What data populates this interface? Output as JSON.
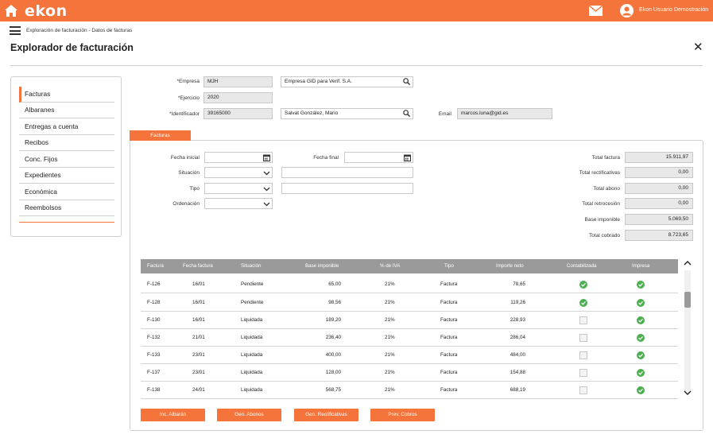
{
  "brand": {
    "logo_text": "ekon",
    "accent_color": "#f4743b"
  },
  "header": {
    "user_name": "Ekon Usuario Demostración",
    "home_icon": "home-icon",
    "mail_icon": "mail-icon",
    "user_icon": "user-circle-icon"
  },
  "breadcrumb": "Exploración de facturación - Datos de facturas",
  "page_title": "Explorador de facturación",
  "sidebar": {
    "items": [
      {
        "label": "Facturas",
        "active": true
      },
      {
        "label": "Albaranes"
      },
      {
        "label": "Entregas a cuenta"
      },
      {
        "label": "Recibos"
      },
      {
        "label": "Conc. Fijos"
      },
      {
        "label": "Expedientes"
      },
      {
        "label": "Económica"
      },
      {
        "label": "Reembolsos"
      }
    ]
  },
  "form": {
    "empresa_label": "*Empresa",
    "empresa_code": "MJH",
    "empresa_name": "Empresa GID para Verif. S.A.",
    "ejercicio_label": "*Ejercicio",
    "ejercicio_value": "2020",
    "identificador_label": "*Identificador",
    "identificador_value": "39165000",
    "identificador_name": "Salvat González, Mario",
    "email_label": "Email",
    "email_value": "marcos.luna@gid.es"
  },
  "tab_label": "Facturas",
  "filters": {
    "fecha_inicial_label": "Fecha inicial",
    "fecha_final_label": "Fecha final",
    "situacion_label": "Situación",
    "tipo_label": "Tipo",
    "ordenacion_label": "Ordenación",
    "fecha_inicial_value": "",
    "fecha_final_value": "",
    "situacion_value": "",
    "tipo_value": "",
    "ordenacion_value": "",
    "situacion_text": "",
    "tipo_text": ""
  },
  "totals": [
    {
      "label": "Total factura",
      "value": "15.911,97"
    },
    {
      "label": "Total rectificativas",
      "value": "0,00"
    },
    {
      "label": "Total abono",
      "value": "0,00"
    },
    {
      "label": "Total retrocesión",
      "value": "0,00"
    },
    {
      "label": "Base imponible",
      "value": "5.069,50"
    },
    {
      "label": "Total cobrado",
      "value": "8.723,65"
    }
  ],
  "table": {
    "columns": [
      "Factura",
      "Fecha factura",
      "Situación",
      "Base imponible",
      "% de IVA",
      "Tipo",
      "Importe neto",
      "Contabilizada",
      "Impresa"
    ],
    "rows": [
      {
        "factura": "F-126",
        "fecha": "16/01",
        "situacion": "Pendiente",
        "base": "65,00",
        "iva": "21%",
        "tipo": "Factura",
        "importe": "78,65",
        "contabilizada": true,
        "impresa": true
      },
      {
        "factura": "F-128",
        "fecha": "16/01",
        "situacion": "Pendiente",
        "base": "98,56",
        "iva": "21%",
        "tipo": "Factura",
        "importe": "119,26",
        "contabilizada": true,
        "impresa": true
      },
      {
        "factura": "F-130",
        "fecha": "16/01",
        "situacion": "Liquidada",
        "base": "189,20",
        "iva": "21%",
        "tipo": "Factura",
        "importe": "228,93",
        "contabilizada": false,
        "impresa": true
      },
      {
        "factura": "F-132",
        "fecha": "21/01",
        "situacion": "Liquidada",
        "base": "236,40",
        "iva": "21%",
        "tipo": "Factura",
        "importe": "286,04",
        "contabilizada": false,
        "impresa": true
      },
      {
        "factura": "F-133",
        "fecha": "23/01",
        "situacion": "Liquidada",
        "base": "400,00",
        "iva": "21%",
        "tipo": "Factura",
        "importe": "484,00",
        "contabilizada": false,
        "impresa": true
      },
      {
        "factura": "F-137",
        "fecha": "23/01",
        "situacion": "Liquidada",
        "base": "128,00",
        "iva": "21%",
        "tipo": "Factura",
        "importe": "154,88",
        "contabilizada": false,
        "impresa": true
      },
      {
        "factura": "F-138",
        "fecha": "24/01",
        "situacion": "Liquidada",
        "base": "568,75",
        "iva": "21%",
        "tipo": "Factura",
        "importe": "688,19",
        "contabilizada": false,
        "impresa": true
      }
    ]
  },
  "actions": [
    "Inc. Albarán",
    "Gen. Abonos",
    "Gen. Rectificativas",
    "Prev. Cobros"
  ],
  "status_colors": {
    "ok": "#4caf50"
  }
}
